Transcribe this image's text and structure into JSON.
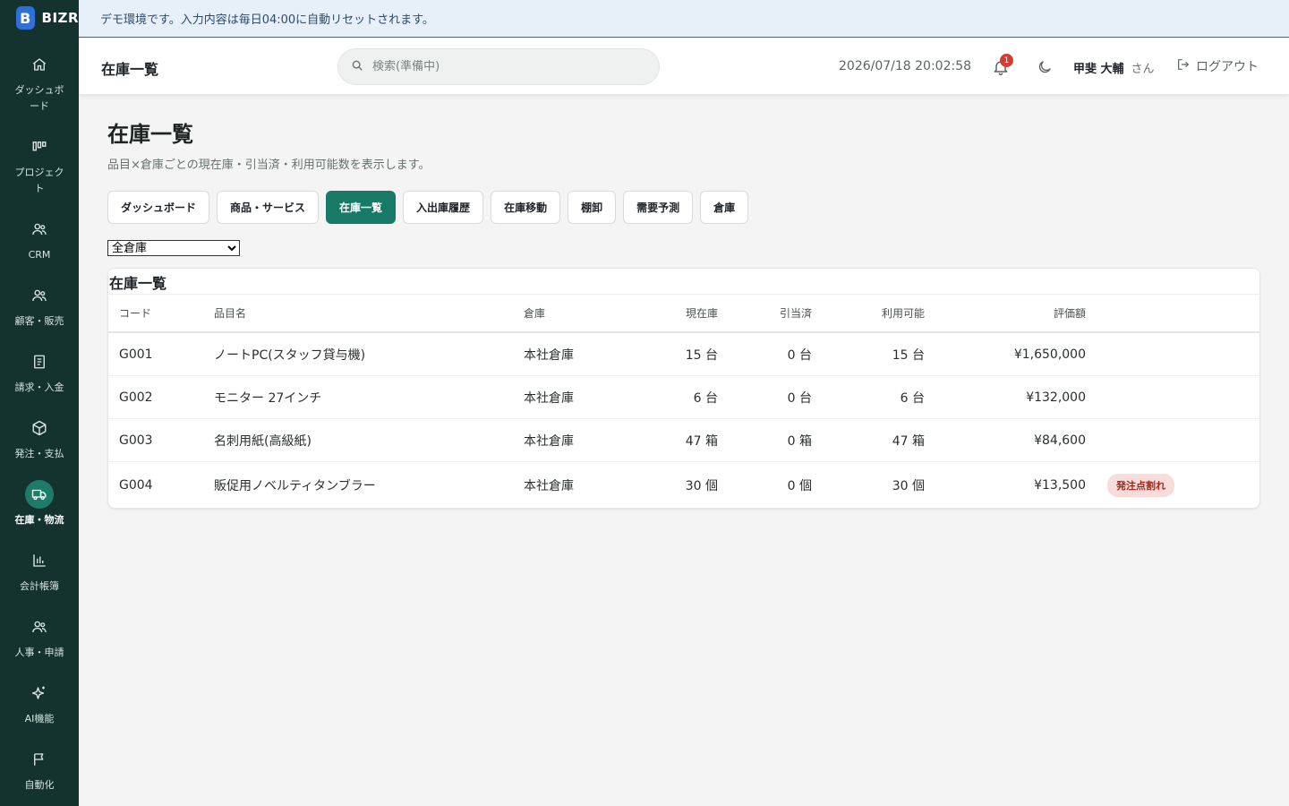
{
  "brand": {
    "logo_letter": "B",
    "name": "BIZR"
  },
  "banner": {
    "text": "デモ環境です。入力内容は毎日04:00に自動リセットされます。"
  },
  "sidebar": {
    "items": [
      {
        "label": "ダッシュボード",
        "icon": "home-icon"
      },
      {
        "label": "プロジェクト",
        "icon": "kanban-icon"
      },
      {
        "label": "CRM",
        "icon": "users-icon"
      },
      {
        "label": "顧客・販売",
        "icon": "customers-icon"
      },
      {
        "label": "請求・入金",
        "icon": "document-icon"
      },
      {
        "label": "発注・支払",
        "icon": "box-icon"
      },
      {
        "label": "在庫・物流",
        "icon": "truck-icon",
        "active": true
      },
      {
        "label": "会計帳簿",
        "icon": "bar-chart-icon"
      },
      {
        "label": "人事・申請",
        "icon": "people-icon"
      },
      {
        "label": "AI機能",
        "icon": "sparkle-icon"
      },
      {
        "label": "自動化",
        "icon": "flag-icon"
      }
    ]
  },
  "header": {
    "title": "在庫一覧",
    "search_placeholder": "検索(準備中)",
    "datetime": "2026/07/18 20:02:58",
    "notification_count": "1",
    "user_name": "甲斐 大輔",
    "user_suffix": "さん",
    "logout_label": "ログアウト"
  },
  "page": {
    "title": "在庫一覧",
    "description": "品目×倉庫ごとの現在庫・引当済・利用可能数を表示します。",
    "tabs": [
      {
        "label": "ダッシュボード"
      },
      {
        "label": "商品・サービス"
      },
      {
        "label": "在庫一覧",
        "active": true
      },
      {
        "label": "入出庫履歴"
      },
      {
        "label": "在庫移動"
      },
      {
        "label": "棚卸"
      },
      {
        "label": "需要予測"
      },
      {
        "label": "倉庫"
      }
    ],
    "warehouse_filter": {
      "selected": "全倉庫"
    }
  },
  "table": {
    "title": "在庫一覧",
    "columns": {
      "code": "コード",
      "name": "品目名",
      "warehouse": "倉庫",
      "current": "現在庫",
      "reserved": "引当済",
      "available": "利用可能",
      "value": "評価額"
    },
    "rows": [
      {
        "code": "G001",
        "name": "ノートPC(スタッフ貸与機)",
        "warehouse": "本社倉庫",
        "current": "15 台",
        "reserved": "0 台",
        "available": "15 台",
        "value": "¥1,650,000",
        "tag": ""
      },
      {
        "code": "G002",
        "name": "モニター 27インチ",
        "warehouse": "本社倉庫",
        "current": "6 台",
        "reserved": "0 台",
        "available": "6 台",
        "value": "¥132,000",
        "tag": ""
      },
      {
        "code": "G003",
        "name": "名刺用紙(高級紙)",
        "warehouse": "本社倉庫",
        "current": "47 箱",
        "reserved": "0 箱",
        "available": "47 箱",
        "value": "¥84,600",
        "tag": ""
      },
      {
        "code": "G004",
        "name": "販促用ノベルティタンブラー",
        "warehouse": "本社倉庫",
        "current": "30 個",
        "reserved": "0 個",
        "available": "30 個",
        "value": "¥13,500",
        "tag": "発注点割れ"
      }
    ]
  },
  "colors": {
    "sidebar_bg": "#14332e",
    "accent": "#177a67",
    "banner_bg": "#e7eff8",
    "alert_pill_bg": "#f8dcda",
    "alert_pill_text": "#a3261e",
    "badge": "#d63b2f"
  }
}
